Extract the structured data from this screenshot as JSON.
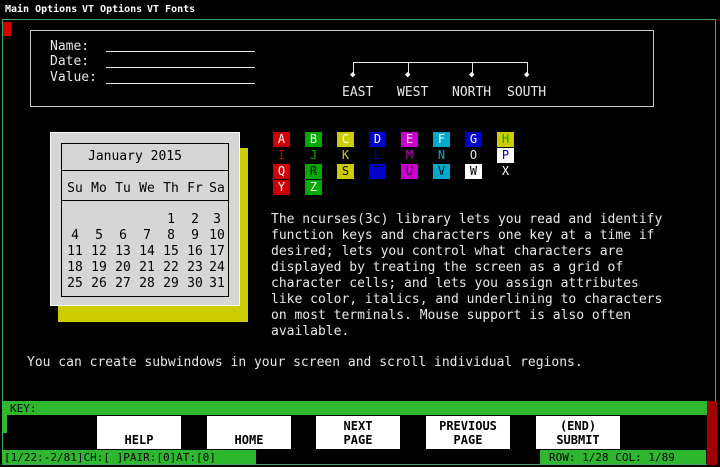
{
  "menu": {
    "items": [
      "Main Options",
      "VT Options",
      "VT Fonts"
    ]
  },
  "form": {
    "name_label": "Name:",
    "date_label": "Date:",
    "value_label": "Value:"
  },
  "tree": {
    "directions": [
      "EAST",
      "WEST",
      "NORTH",
      "SOUTH"
    ]
  },
  "calendar": {
    "title": "January 2015",
    "weekdays": [
      "Su",
      "Mo",
      "Tu",
      "We",
      "Th",
      "Fr",
      "Sa"
    ],
    "weeks": [
      [
        "",
        "",
        "",
        "",
        "1",
        "2",
        "3"
      ],
      [
        "4",
        "5",
        "6",
        "7",
        "8",
        "9",
        "10"
      ],
      [
        "11",
        "12",
        "13",
        "14",
        "15",
        "16",
        "17"
      ],
      [
        "18",
        "19",
        "20",
        "21",
        "22",
        "23",
        "24"
      ],
      [
        "25",
        "26",
        "27",
        "28",
        "29",
        "30",
        "31"
      ]
    ]
  },
  "color_grid": {
    "rows": [
      [
        {
          "ch": "A",
          "bg": "#cc0000",
          "fg": "#ffffff"
        },
        {
          "ch": "B",
          "bg": "#00aa00",
          "fg": "#ffffff"
        },
        {
          "ch": "C",
          "bg": "#cccc00",
          "fg": "#ffffff"
        },
        {
          "ch": "D",
          "bg": "#0000cc",
          "fg": "#ffffff"
        },
        {
          "ch": "E",
          "bg": "#cc00cc",
          "fg": "#ffffff"
        },
        {
          "ch": "F",
          "bg": "#00aacc",
          "fg": "#ffffff"
        },
        {
          "ch": "G",
          "bg": "#0000cc",
          "fg": "#ffffff"
        },
        {
          "ch": "H",
          "bg": "#cccc00",
          "fg": "#00aa00"
        }
      ],
      [
        {
          "ch": "I",
          "bg": "#000000",
          "fg": "#cc0000"
        },
        {
          "ch": "J",
          "bg": "#000000",
          "fg": "#00aa00"
        },
        {
          "ch": "K",
          "bg": "#000000",
          "fg": "#cccc00"
        },
        {
          "ch": "L",
          "bg": "#000000",
          "fg": "#0000cc"
        },
        {
          "ch": "M",
          "bg": "#000000",
          "fg": "#cc00cc"
        },
        {
          "ch": "N",
          "bg": "#000000",
          "fg": "#00aacc"
        },
        {
          "ch": "O",
          "bg": "#000000",
          "fg": "#e8e8e8"
        },
        {
          "ch": "P",
          "bg": "#ffffff",
          "fg": "#0000cc"
        }
      ],
      [
        {
          "ch": "Q",
          "bg": "#cc0000",
          "fg": "#ffffff"
        },
        {
          "ch": "R",
          "bg": "#00aa00",
          "fg": "#000000"
        },
        {
          "ch": "S",
          "bg": "#cccc00",
          "fg": "#000000"
        },
        {
          "ch": "T",
          "bg": "#0000cc",
          "fg": "#000000"
        },
        {
          "ch": "U",
          "bg": "#cc00cc",
          "fg": "#000000"
        },
        {
          "ch": "V",
          "bg": "#00aacc",
          "fg": "#000000"
        },
        {
          "ch": "W",
          "bg": "#ffffff",
          "fg": "#000000"
        },
        {
          "ch": "X",
          "bg": "#000000",
          "fg": "#ffffff"
        }
      ],
      [
        {
          "ch": "Y",
          "bg": "#cc0000",
          "fg": "#ffffff"
        },
        {
          "ch": "Z",
          "bg": "#00aa00",
          "fg": "#ffffff"
        }
      ]
    ]
  },
  "description": [
    "The ncurses(3c) library lets you read and identify",
    "function keys and characters one key at a time if",
    "desired; lets you control what characters are",
    "displayed by treating the screen as a grid of",
    "character cells; and lets you assign attributes",
    "like color, italics, and underlining to characters",
    "on most terminals. Mouse support is also often",
    "available."
  ],
  "subwindow_note": "You can create subwindows in your screen and scroll individual regions.",
  "keybar": {
    "label": "KEY:"
  },
  "function_keys": [
    {
      "line1": "",
      "line2": "HELP"
    },
    {
      "line1": "",
      "line2": "HOME"
    },
    {
      "line1": "NEXT",
      "line2": "PAGE"
    },
    {
      "line1": "PREVIOUS",
      "line2": "PAGE"
    },
    {
      "line1": "(END)",
      "line2": "SUBMIT"
    }
  ],
  "status": {
    "left": "[1/22:-2/81]CH:[ ]PAIR:[0]AT:[0]",
    "right": "ROW: 1/28 COL: 1/89"
  },
  "colors": {
    "accent_green": "#2eb82e",
    "accent_red": "#d40000",
    "calendar_shadow": "#cccc00"
  }
}
